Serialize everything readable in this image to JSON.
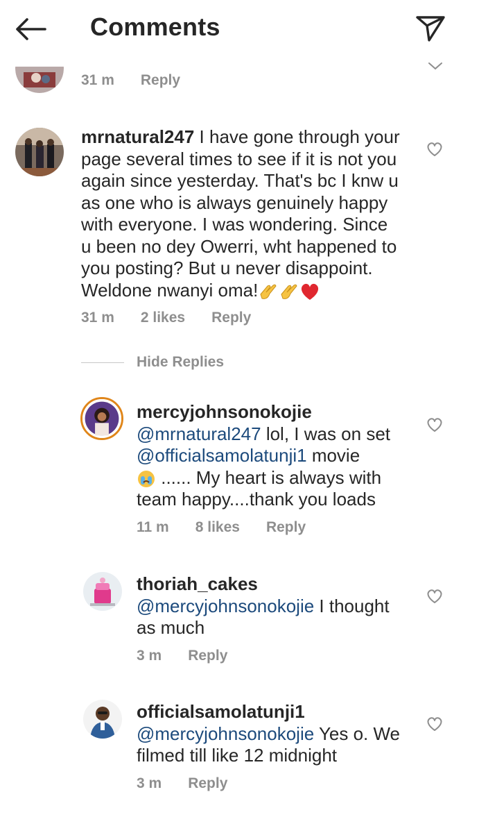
{
  "header": {
    "title": "Comments"
  },
  "partial_comment": {
    "time": "31 m",
    "reply_label": "Reply"
  },
  "comment1": {
    "username": "mrnatural247",
    "lines": [
      " I have gone through your",
      "page several times to see if it is not you",
      "again since yesterday. That's bc I knw u",
      "as one who is always genuinely happy",
      "with everyone. I was wondering. Since",
      "u been no dey Owerri, wht happened to",
      "you posting? But u never disappoint.",
      "Weldone nwanyi oma!"
    ],
    "time": "31 m",
    "likes": "2 likes",
    "reply_label": "Reply"
  },
  "hide_replies_label": "Hide Replies",
  "reply1": {
    "username": "mercyjohnsonokojie",
    "mention": "@mrnatural247",
    "line1_rest": "  lol, I was on set",
    "mention2": "@officialsamolatunji1",
    "line2_rest": "  movie",
    "line3_rest": " ...... My heart is always with",
    "line4": "team happy....thank you loads",
    "time": "11 m",
    "likes": "8 likes",
    "reply_label": "Reply"
  },
  "reply2": {
    "username": "thoriah_cakes",
    "mention": "@mercyjohnsonokojie",
    "line1_rest": " I thought",
    "line2": "as much",
    "time": "3 m",
    "reply_label": "Reply"
  },
  "reply3": {
    "username": "officialsamolatunji1",
    "mention": "@mercyjohnsonokojie",
    "line1_rest": " Yes o. We",
    "line2": "filmed till like 12 midnight",
    "time": "3 m",
    "reply_label": "Reply"
  },
  "icons": {
    "back": "arrow-left-icon",
    "send": "paper-plane-icon",
    "like": "heart-outline-icon",
    "collapse": "chevron-down-icon"
  },
  "colors": {
    "text": "#262626",
    "muted": "#8e8e8e",
    "mention": "#1c4a7c"
  }
}
